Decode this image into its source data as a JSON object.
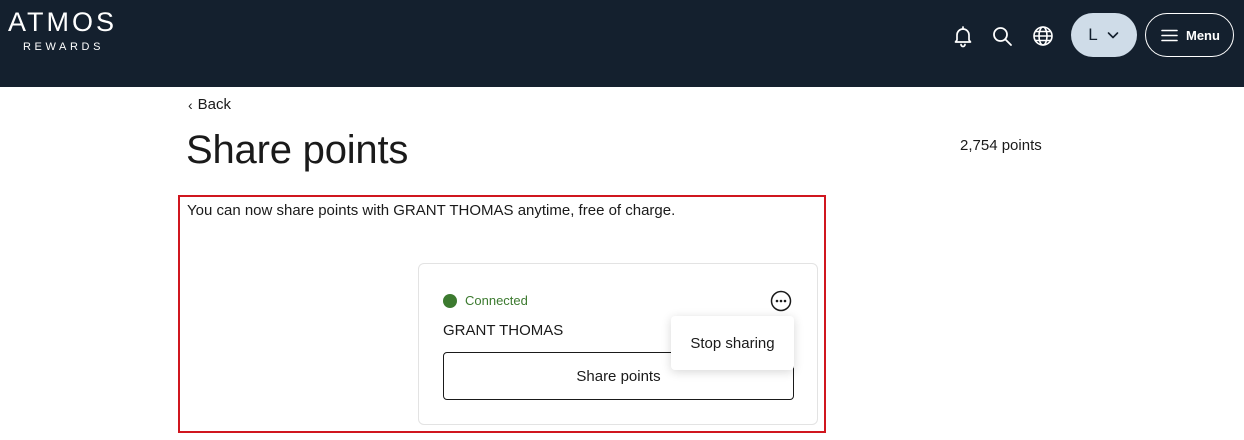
{
  "header": {
    "logo_main": "ATMOS",
    "logo_sub": "REWARDS",
    "icons": [
      "bell-icon",
      "search-icon",
      "globe-icon"
    ],
    "avatar_letter": "L",
    "menu_label": "Menu"
  },
  "main": {
    "back_label": "Back",
    "title": "Share points",
    "points_balance": "2,754 points",
    "info_text": "You can now share points with GRANT THOMAS anytime, free of charge."
  },
  "card": {
    "status": "Connected",
    "member_name": "GRANT THOMAS",
    "share_button": "Share points"
  },
  "dropdown": {
    "items": [
      {
        "label": "Stop sharing"
      }
    ]
  },
  "colors": {
    "header_bg": "#14202e",
    "avatar_bg": "#cfdce8",
    "status_green": "#3c7a2f",
    "highlight_red": "#d0161f"
  }
}
